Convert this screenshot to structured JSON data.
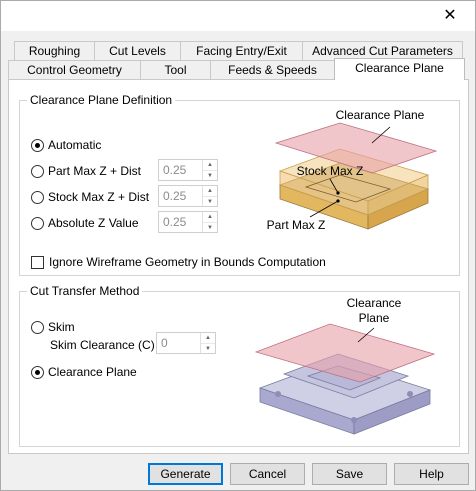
{
  "window": {
    "close_glyph": "✕"
  },
  "tabs_back": [
    "Roughing",
    "Cut Levels",
    "Facing Entry/Exit",
    "Advanced Cut Parameters"
  ],
  "tabs_front": [
    "Control Geometry",
    "Tool",
    "Feeds & Speeds",
    "Clearance Plane"
  ],
  "active_tab": "Clearance Plane",
  "definition": {
    "title": "Clearance Plane Definition",
    "options": [
      {
        "label": "Automatic",
        "selected": true
      },
      {
        "label": "Part Max Z + Dist",
        "selected": false,
        "value": "0.25"
      },
      {
        "label": "Stock Max Z + Dist",
        "selected": false,
        "value": "0.25"
      },
      {
        "label": "Absolute Z Value",
        "selected": false,
        "value": "0.25"
      }
    ],
    "ignore_wireframe_label": "Ignore Wireframe Geometry in Bounds Computation",
    "ignore_wireframe_checked": false,
    "figure_labels": {
      "plane": "Clearance Plane",
      "stock": "Stock Max Z",
      "part": "Part Max Z"
    }
  },
  "transfer": {
    "title": "Cut Transfer Method",
    "skim_label": "Skim",
    "skim_selected": false,
    "skim_clearance_label": "Skim Clearance (C)",
    "skim_clearance_value": "0",
    "clearance_plane_label": "Clearance Plane",
    "clearance_plane_selected": true,
    "figure_label_line1": "Clearance",
    "figure_label_line2": "Plane"
  },
  "buttons": {
    "generate": "Generate",
    "cancel": "Cancel",
    "save": "Save",
    "help": "Help"
  },
  "colors": {
    "plane": "#e8a0a8",
    "stock": "#f0c070",
    "part": "#b9b9d8",
    "accent": "#0078d7"
  }
}
